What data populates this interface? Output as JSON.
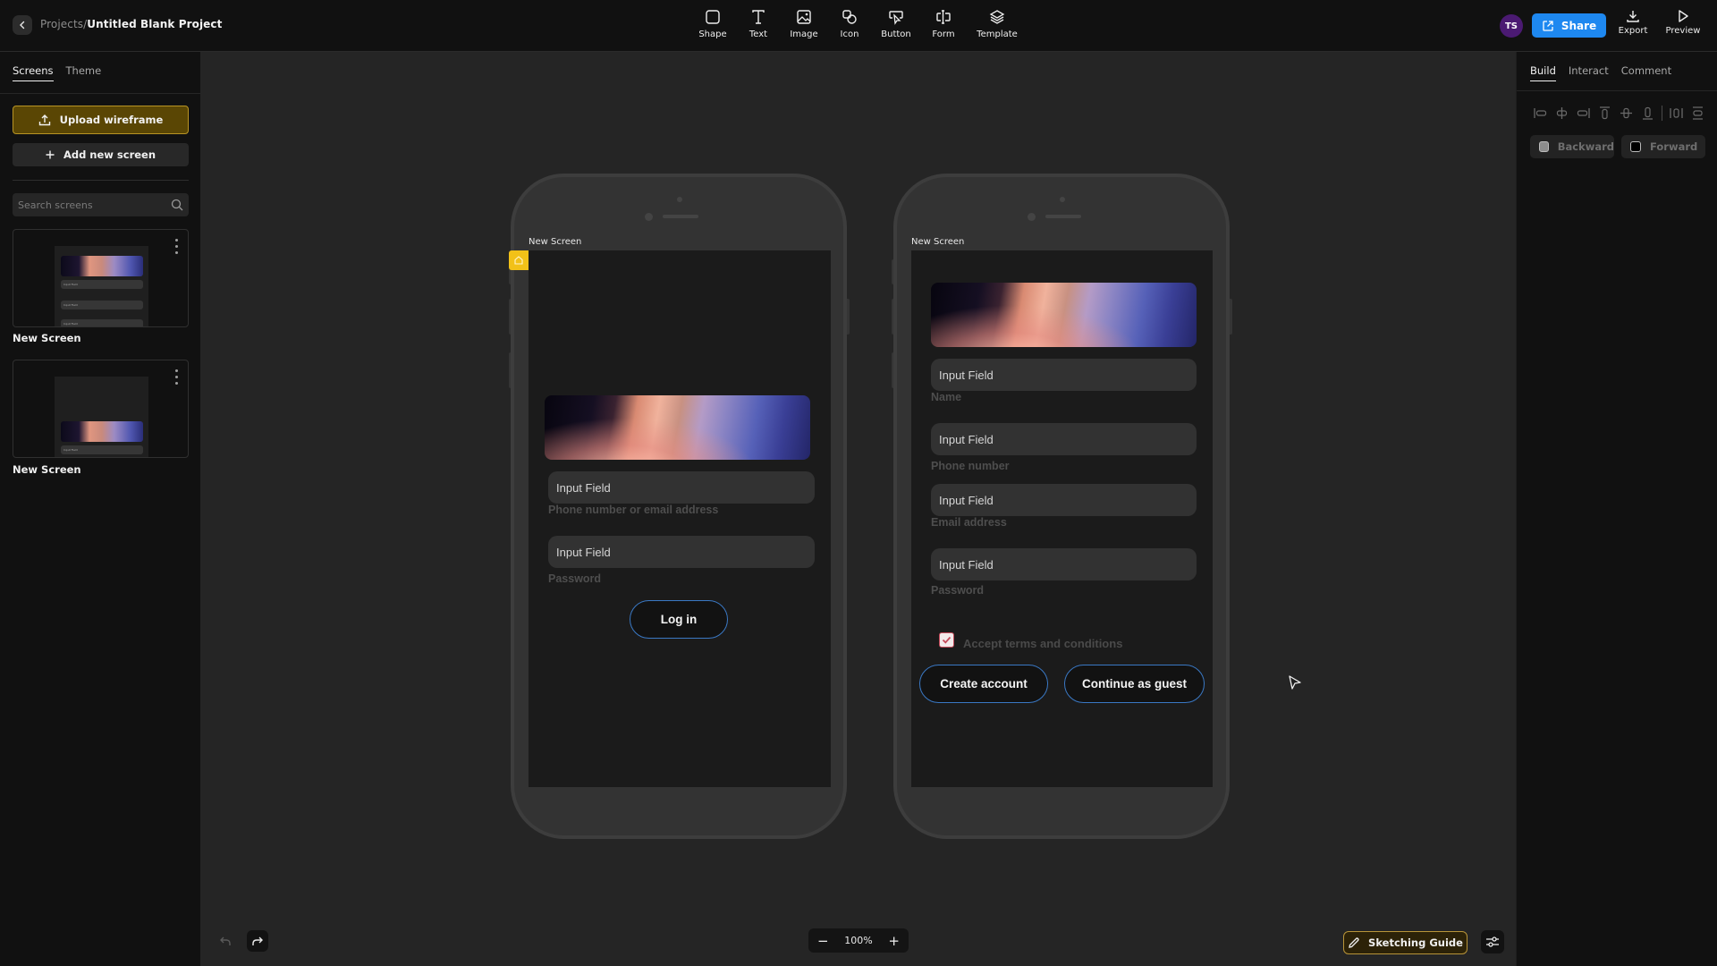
{
  "topbar": {
    "breadcrumb_parent": "Projects",
    "breadcrumb_separator": "/",
    "project_title": "Untitled Blank Project",
    "tools": [
      {
        "label": "Shape",
        "icon": "square-icon"
      },
      {
        "label": "Text",
        "icon": "text-icon"
      },
      {
        "label": "Image",
        "icon": "image-icon"
      },
      {
        "label": "Icon",
        "icon": "shapes-icon"
      },
      {
        "label": "Button",
        "icon": "button-cursor-icon"
      },
      {
        "label": "Form",
        "icon": "form-field-icon"
      },
      {
        "label": "Template",
        "icon": "layers-icon"
      }
    ],
    "avatar_initials": "TS",
    "share_label": "Share",
    "export_label": "Export",
    "preview_label": "Preview",
    "colors": {
      "share": "#1e88f0",
      "avatar": "#4b1a72"
    }
  },
  "sidebar": {
    "tabs": [
      {
        "label": "Screens",
        "active": true
      },
      {
        "label": "Theme",
        "active": false
      }
    ],
    "upload_label": "Upload wireframe",
    "add_screen_label": "Add new screen",
    "search_placeholder": "Search screens",
    "search_value": "",
    "screens": [
      {
        "label": "New Screen",
        "thumb_field_text": "Input Field"
      },
      {
        "label": "New Screen",
        "thumb_field_text": "Input Field"
      }
    ]
  },
  "canvas": {
    "screens": [
      {
        "label": "New Screen",
        "fields": [
          {
            "value": "Input Field",
            "label": "Phone number or email address"
          },
          {
            "value": "Input Field",
            "label": "Password"
          }
        ],
        "buttons": [
          {
            "label": "Log in"
          }
        ]
      },
      {
        "label": "New Screen",
        "fields": [
          {
            "value": "Input Field",
            "label": "Name"
          },
          {
            "value": "Input Field",
            "label": "Phone number"
          },
          {
            "value": "Input Field",
            "label": "Email address"
          },
          {
            "value": "Input Field",
            "label": "Password"
          }
        ],
        "checkbox": {
          "label": "Accept terms and conditions",
          "checked": true
        },
        "buttons": [
          {
            "label": "Create account"
          },
          {
            "label": "Continue as guest"
          }
        ]
      }
    ],
    "zoom_level": "100%",
    "sketching_guide_label": "Sketching Guide"
  },
  "rightpanel": {
    "tabs": [
      {
        "label": "Build",
        "active": true
      },
      {
        "label": "Interact",
        "active": false
      },
      {
        "label": "Comment",
        "active": false
      }
    ],
    "align_tools": [
      "align-left-icon",
      "align-center-h-icon",
      "align-right-icon",
      "align-top-icon",
      "align-middle-v-icon",
      "align-bottom-icon",
      "distribute-horizontal-icon",
      "distribute-vertical-icon"
    ],
    "backward_label": "Backward",
    "forward_label": "Forward"
  }
}
